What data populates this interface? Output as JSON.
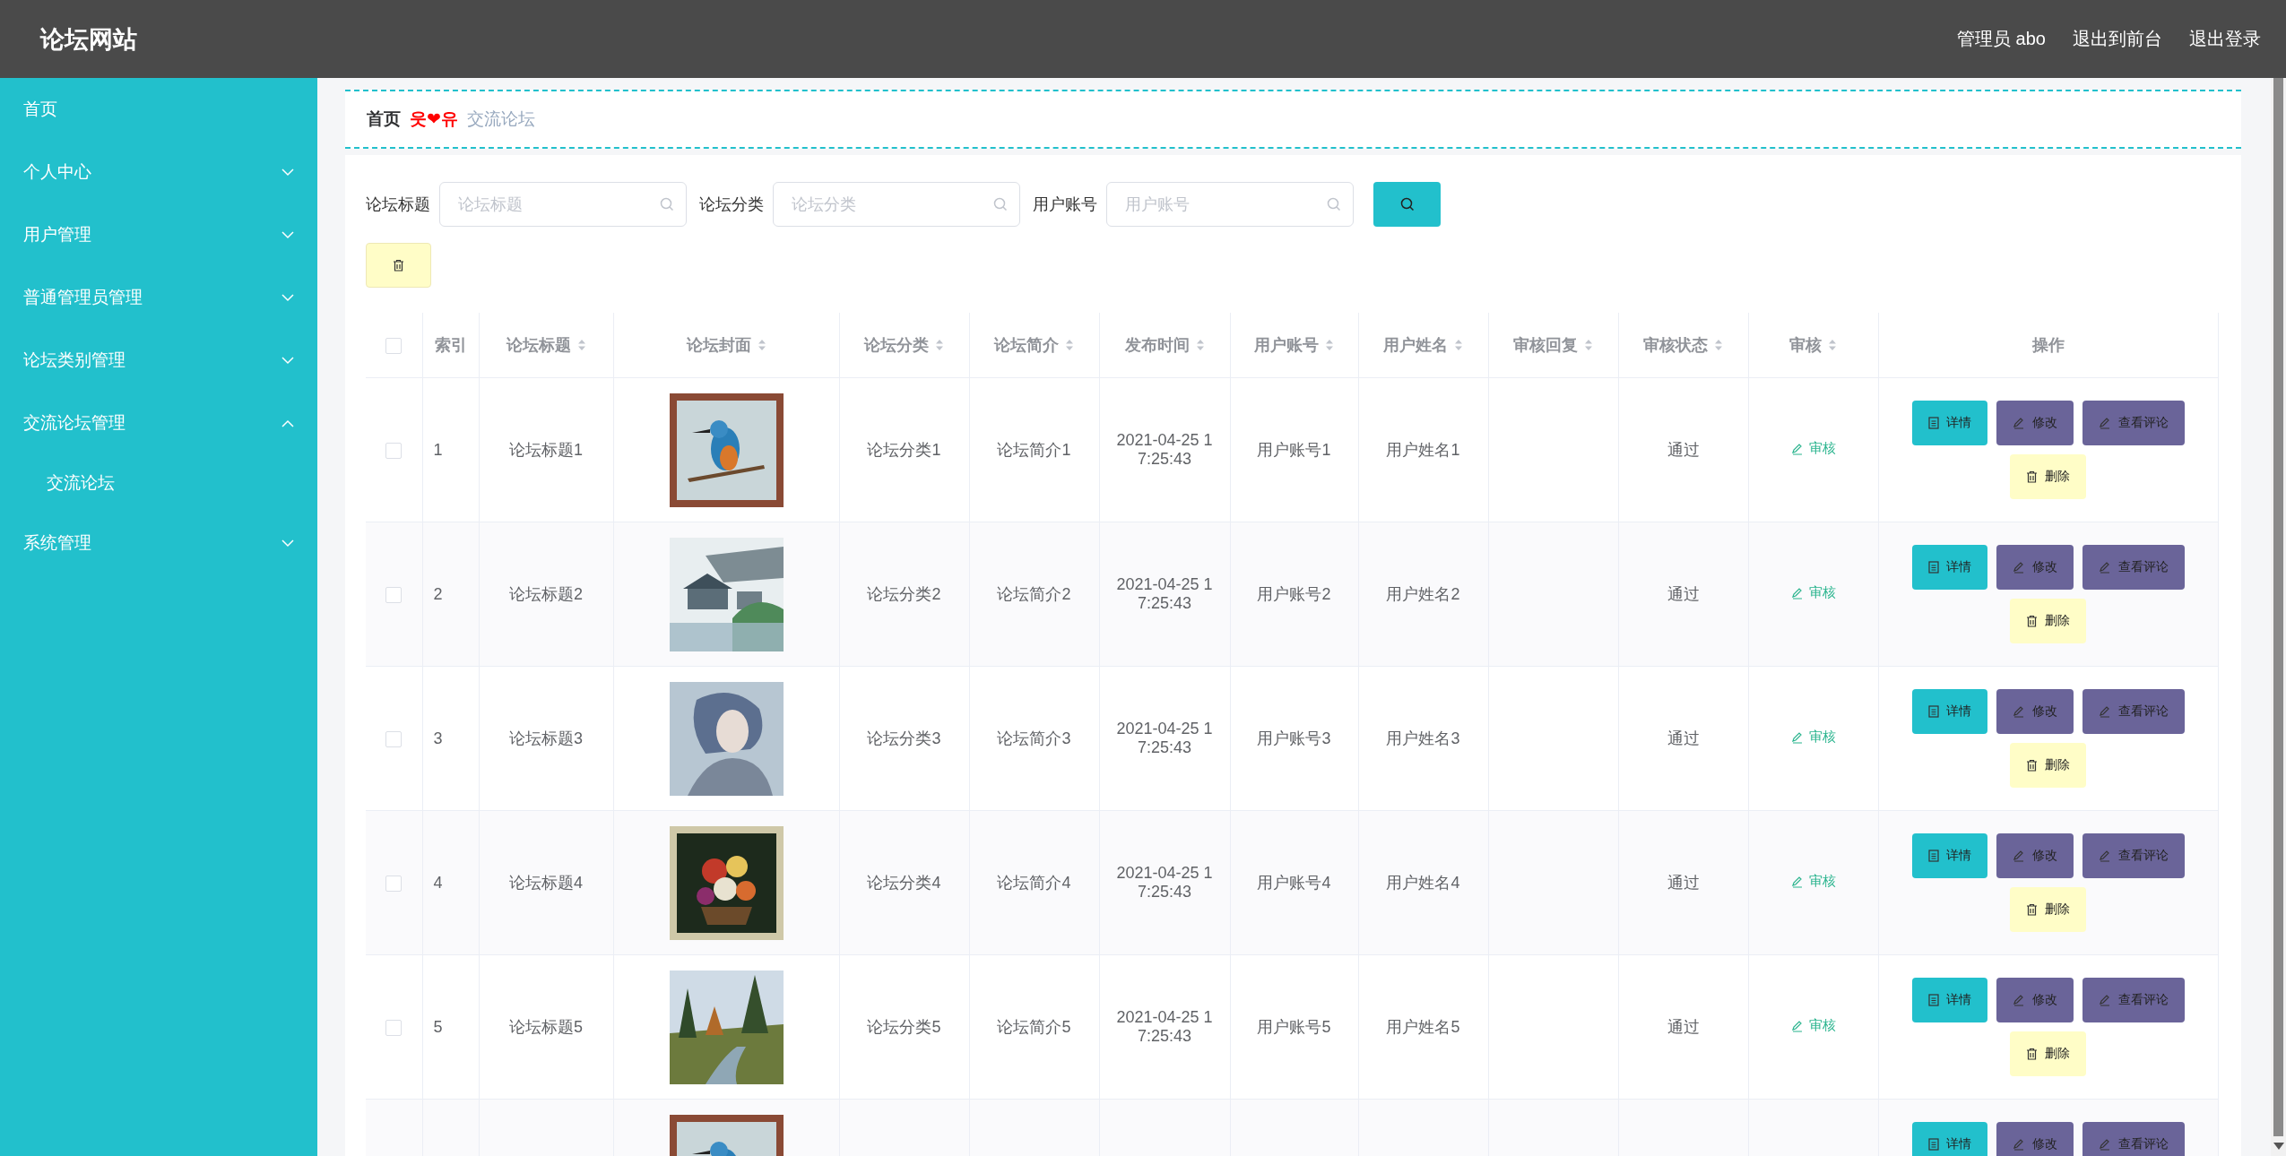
{
  "header": {
    "title": "论坛网站",
    "links": [
      "管理员 abo",
      "退出到前台",
      "退出登录"
    ]
  },
  "sidebar": {
    "items": [
      {
        "label": "首页",
        "kind": "link"
      },
      {
        "label": "个人中心",
        "kind": "menu",
        "expanded": false
      },
      {
        "label": "用户管理",
        "kind": "menu",
        "expanded": false
      },
      {
        "label": "普通管理员管理",
        "kind": "menu",
        "expanded": false
      },
      {
        "label": "论坛类别管理",
        "kind": "menu",
        "expanded": false
      },
      {
        "label": "交流论坛管理",
        "kind": "menu",
        "expanded": true,
        "children": [
          {
            "label": "交流论坛"
          }
        ]
      },
      {
        "label": "系统管理",
        "kind": "menu",
        "expanded": false
      }
    ]
  },
  "breadcrumb": {
    "home": "首页",
    "separator": "웃❤유",
    "current": "交流论坛"
  },
  "search": {
    "fields": [
      {
        "label": "论坛标题",
        "placeholder": "论坛标题"
      },
      {
        "label": "论坛分类",
        "placeholder": "论坛分类"
      },
      {
        "label": "用户账号",
        "placeholder": "用户账号"
      }
    ]
  },
  "table": {
    "select_all": {
      "checked": false
    },
    "columns": [
      {
        "label": "索引",
        "sortable": false
      },
      {
        "label": "论坛标题",
        "sortable": true
      },
      {
        "label": "论坛封面",
        "sortable": true
      },
      {
        "label": "论坛分类",
        "sortable": true
      },
      {
        "label": "论坛简介",
        "sortable": true
      },
      {
        "label": "发布时间",
        "sortable": true
      },
      {
        "label": "用户账号",
        "sortable": true
      },
      {
        "label": "用户姓名",
        "sortable": true
      },
      {
        "label": "审核回复",
        "sortable": true
      },
      {
        "label": "审核状态",
        "sortable": true
      },
      {
        "label": "审核",
        "sortable": true
      },
      {
        "label": "操作",
        "sortable": false
      }
    ],
    "rows": [
      {
        "checked": false,
        "index": "1",
        "title": "论坛标题1",
        "cover": {
          "kind": "picture"
        },
        "category": "论坛分类1",
        "intro": "论坛简介1",
        "time": [
          "2021-04-25 1",
          "7:25:43"
        ],
        "account": "用户账号1",
        "name": "用户姓名1",
        "status": "通过",
        "review": "审核",
        "actions": [
          {
            "label": "详情",
            "kind": "detail"
          },
          {
            "label": "修改",
            "kind": "edit"
          },
          {
            "label": "查看评论",
            "kind": "edit"
          },
          {
            "label": "删除",
            "kind": "delete"
          }
        ]
      },
      {
        "checked": false,
        "index": "2",
        "title": "论坛标题2",
        "cover": {
          "kind": "picture"
        },
        "category": "论坛分类2",
        "intro": "论坛简介2",
        "time": [
          "2021-04-25 1",
          "7:25:43"
        ],
        "account": "用户账号2",
        "name": "用户姓名2",
        "status": "通过",
        "review": "审核",
        "actions": [
          {
            "label": "详情",
            "kind": "detail"
          },
          {
            "label": "修改",
            "kind": "edit"
          },
          {
            "label": "查看评论",
            "kind": "edit"
          },
          {
            "label": "删除",
            "kind": "delete"
          }
        ]
      },
      {
        "checked": false,
        "index": "3",
        "title": "论坛标题3",
        "cover": {
          "kind": "picture"
        },
        "category": "论坛分类3",
        "intro": "论坛简介3",
        "time": [
          "2021-04-25 1",
          "7:25:43"
        ],
        "account": "用户账号3",
        "name": "用户姓名3",
        "status": "通过",
        "review": "审核",
        "actions": [
          {
            "label": "详情",
            "kind": "detail"
          },
          {
            "label": "修改",
            "kind": "edit"
          },
          {
            "label": "查看评论",
            "kind": "edit"
          },
          {
            "label": "删除",
            "kind": "delete"
          }
        ]
      },
      {
        "checked": false,
        "index": "4",
        "title": "论坛标题4",
        "cover": {
          "kind": "picture"
        },
        "category": "论坛分类4",
        "intro": "论坛简介4",
        "time": [
          "2021-04-25 1",
          "7:25:43"
        ],
        "account": "用户账号4",
        "name": "用户姓名4",
        "status": "通过",
        "review": "审核",
        "actions": [
          {
            "label": "详情",
            "kind": "detail"
          },
          {
            "label": "修改",
            "kind": "edit"
          },
          {
            "label": "查看评论",
            "kind": "edit"
          },
          {
            "label": "删除",
            "kind": "delete"
          }
        ]
      },
      {
        "checked": false,
        "index": "5",
        "title": "论坛标题5",
        "cover": {
          "kind": "picture"
        },
        "category": "论坛分类5",
        "intro": "论坛简介5",
        "time": [
          "2021-04-25 1",
          "7:25:43"
        ],
        "account": "用户账号5",
        "name": "用户姓名5",
        "status": "通过",
        "review": "审核",
        "actions": [
          {
            "label": "详情",
            "kind": "detail"
          },
          {
            "label": "修改",
            "kind": "edit"
          },
          {
            "label": "查看评论",
            "kind": "edit"
          },
          {
            "label": "删除",
            "kind": "delete"
          }
        ]
      },
      {
        "cover": {
          "kind": "picture"
        },
        "actions": [
          {
            "label": "详情",
            "kind": "detail"
          },
          {
            "label": "修改",
            "kind": "edit"
          },
          {
            "label": "查看评论",
            "kind": "edit"
          }
        ]
      }
    ]
  }
}
